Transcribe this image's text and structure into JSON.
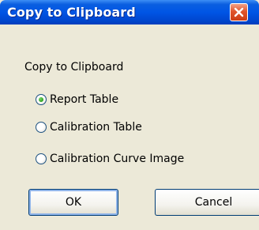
{
  "window": {
    "title": "Copy to Clipboard"
  },
  "group": {
    "label": "Copy to Clipboard"
  },
  "options": [
    {
      "label": "Report Table",
      "selected": true
    },
    {
      "label": "Calibration Table",
      "selected": false
    },
    {
      "label": "Calibration Curve Image",
      "selected": false
    }
  ],
  "buttons": {
    "ok_label": "OK",
    "cancel_label": "Cancel"
  },
  "icons": {
    "close": "close-icon"
  },
  "colors": {
    "titlebar": "#0055e5",
    "close_button": "#e0542b",
    "dialog_background": "#ece9d8",
    "radio_selected": "#2b9f1c"
  }
}
